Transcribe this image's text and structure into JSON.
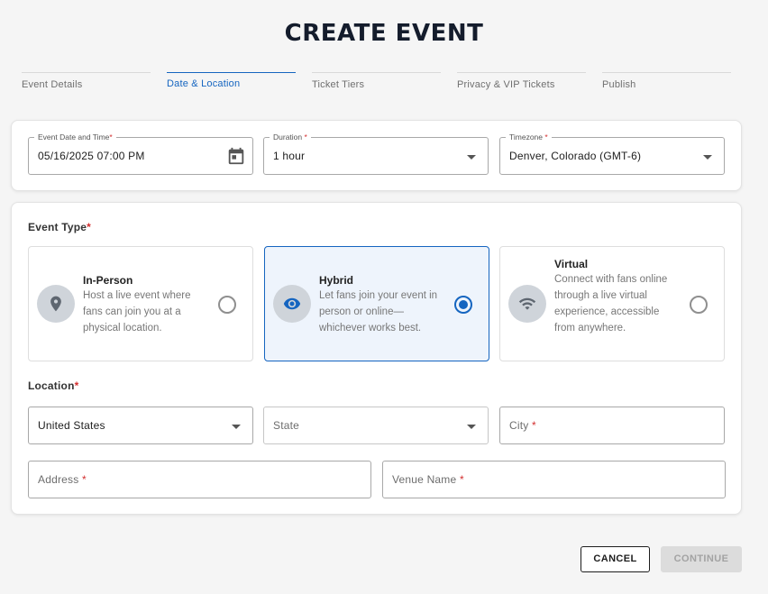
{
  "page": {
    "title": "CREATE EVENT"
  },
  "steps": [
    {
      "label": "Event Details"
    },
    {
      "label": "Date & Location"
    },
    {
      "label": "Ticket Tiers"
    },
    {
      "label": "Privacy & VIP Tickets"
    },
    {
      "label": "Publish"
    }
  ],
  "active_step": "Date & Location",
  "datetime": {
    "event_date": {
      "label": "Event Date and Time",
      "value": "05/16/2025 07:00 PM"
    },
    "duration": {
      "label": "Duration",
      "value": "1 hour"
    },
    "timezone": {
      "label": "Timezone",
      "value": "Denver, Colorado (GMT-6)"
    }
  },
  "event_type": {
    "label": "Event Type",
    "options": [
      {
        "title": "In-Person",
        "description": "Host a live event where fans can join you at a physical location.",
        "icon": "location-pin-icon"
      },
      {
        "title": "Hybrid",
        "description": "Let fans join your event in person or online—whichever works best.",
        "icon": "eye-icon"
      },
      {
        "title": "Virtual",
        "description": "Connect with fans online through a live virtual experience, accessible from anywhere.",
        "icon": "wifi-icon"
      }
    ],
    "selected": "Hybrid"
  },
  "location": {
    "label": "Location",
    "country": {
      "value": "United States"
    },
    "state": {
      "placeholder": "State"
    },
    "city": {
      "placeholder": "City"
    },
    "address": {
      "placeholder": "Address"
    },
    "venue": {
      "placeholder": "Venue Name"
    }
  },
  "required_marker": "*",
  "actions": {
    "cancel": "CANCEL",
    "continue": "CONTINUE"
  },
  "colors": {
    "accent": "#1565c0",
    "required": "#d32f2f",
    "title": "#141c2c",
    "background": "#f5f5f5"
  }
}
